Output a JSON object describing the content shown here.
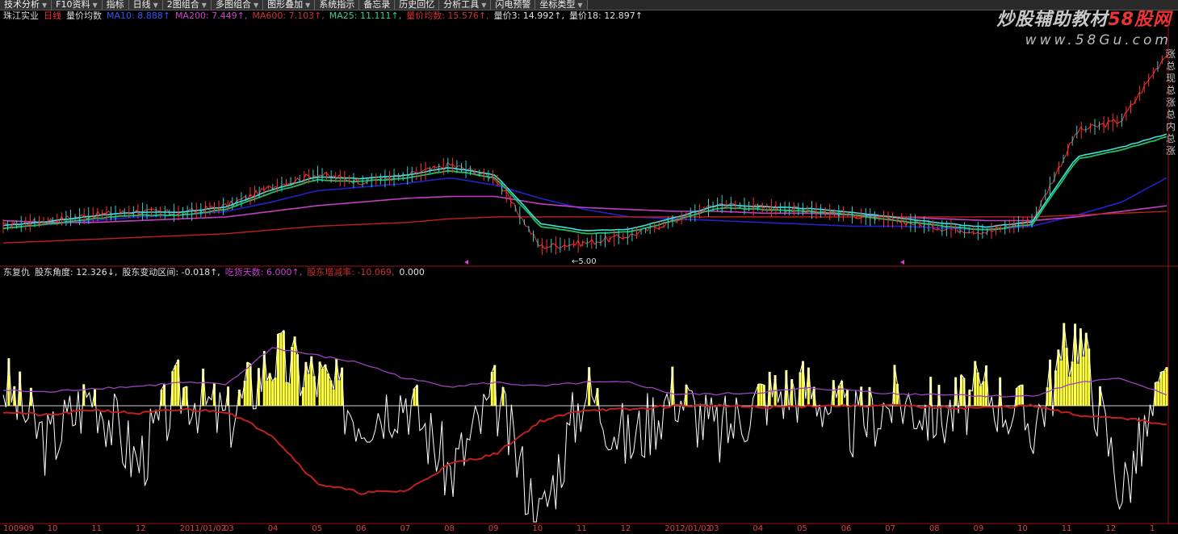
{
  "toolbar": {
    "buttons": [
      {
        "label": "技术分析",
        "dropdown": true
      },
      {
        "label": "F10资料",
        "dropdown": true
      },
      {
        "label": "指标",
        "dropdown": false
      },
      {
        "label": "日线",
        "dropdown": true
      },
      {
        "label": "2图组合",
        "dropdown": true
      },
      {
        "label": "多图组合",
        "dropdown": true
      },
      {
        "label": "图形叠加",
        "dropdown": true
      },
      {
        "label": "系统指示",
        "dropdown": false
      },
      {
        "label": "备忘录",
        "dropdown": false
      },
      {
        "label": "历史回忆",
        "dropdown": false
      },
      {
        "label": "分析工具",
        "dropdown": true
      },
      {
        "label": "闪电预警",
        "dropdown": false
      },
      {
        "label": "坐标类型",
        "dropdown": true
      }
    ],
    "dropdown_glyph": "▼"
  },
  "watermark": {
    "line1_a": "炒股辅助教材",
    "line1_b": "58股网",
    "line2": "www.58Gu.com"
  },
  "main_panel": {
    "stock": "珠江实业",
    "period": "日线",
    "indicator": "量价均数",
    "readouts": [
      {
        "text": "MA10: 8.888↑",
        "color": "#3355ff"
      },
      {
        "text": "MA200: 7.449↑,",
        "color": "#d040d0"
      },
      {
        "text": "MA600: 7.103↑,",
        "color": "#d03030"
      },
      {
        "text": "MA25: 11.111↑,",
        "color": "#30d0a0"
      },
      {
        "text": "量价均数: 15.576↑,",
        "color": "#d03030"
      },
      {
        "text": "量价3: 14.992↑,",
        "color": "#e0e0e0"
      },
      {
        "text": "量价18: 12.897↑",
        "color": "#e0e0e0"
      }
    ],
    "low_marker": "←5.00",
    "side_labels": [
      "涨",
      "总",
      "现",
      "总",
      "涨",
      "总",
      "内",
      "总",
      "涨"
    ]
  },
  "sub_panel": {
    "indicator": "东复仇",
    "readouts": [
      {
        "text": "股东角度: 12.326↓,",
        "color": "#e0e0e0"
      },
      {
        "text": "股东变动区间: -0.018↑,",
        "color": "#e0e0e0"
      },
      {
        "text": "吃货天数: 6.000↑,",
        "color": "#d040d0"
      },
      {
        "text": "股东增减率: -10.069,",
        "color": "#d03030"
      },
      {
        "text": "0.000",
        "color": "#e0e0e0"
      }
    ]
  },
  "date_axis": [
    "100909",
    "10",
    "11",
    "12",
    "2011/01/02",
    "03",
    "04",
    "05",
    "06",
    "07",
    "08",
    "09",
    "10",
    "11",
    "12",
    "2012/01/02",
    "03",
    "04",
    "05",
    "06",
    "07",
    "08",
    "09",
    "10",
    "11",
    "12",
    "1"
  ],
  "colors": {
    "ma_blue": "#2222cc",
    "ma_purple": "#c040c0",
    "ma_red": "#c02020",
    "ma_green": "#20c060",
    "ma_cyan": "#40e0e0",
    "candle_up": "#ff3030",
    "candle_down": "#30d0d0",
    "osc_white": "#ffffff",
    "osc_yellow": "#ffff40",
    "osc_red": "#c02020",
    "osc_purple": "#a040c0",
    "panel_border": "#a01010"
  },
  "chart_data": [
    {
      "type": "line",
      "title": "珠江实业 日线 量价均数",
      "x": [
        "100909",
        "10",
        "11",
        "12",
        "2011/01/02",
        "03",
        "04",
        "05",
        "06",
        "07",
        "08",
        "09",
        "10",
        "11",
        "12",
        "2012/01/02",
        "03",
        "04",
        "05",
        "06",
        "07",
        "08",
        "09",
        "10",
        "11",
        "12",
        "1"
      ],
      "series": [
        {
          "name": "量价均数",
          "values": [
            6.3,
            6.6,
            6.9,
            7.1,
            7.0,
            7.4,
            8.4,
            9.1,
            8.7,
            9.0,
            9.6,
            8.9,
            5.2,
            5.4,
            5.8,
            6.6,
            7.5,
            7.3,
            7.2,
            6.9,
            6.6,
            6.2,
            6.0,
            6.6,
            11.4,
            12.0,
            15.6
          ]
        },
        {
          "name": "MA10",
          "values": [
            6.2,
            6.4,
            6.6,
            6.8,
            6.9,
            7.1,
            7.6,
            8.2,
            8.4,
            8.6,
            8.9,
            8.5,
            7.8,
            7.2,
            6.8,
            6.7,
            6.6,
            6.5,
            6.4,
            6.3,
            6.3,
            6.2,
            6.1,
            6.3,
            6.9,
            7.6,
            8.9
          ]
        },
        {
          "name": "MA200",
          "values": [
            6.6,
            6.5,
            6.5,
            6.6,
            6.7,
            6.8,
            7.1,
            7.4,
            7.6,
            7.8,
            7.9,
            7.9,
            7.5,
            7.3,
            7.2,
            7.1,
            7.1,
            7.0,
            7.0,
            6.9,
            6.8,
            6.7,
            6.6,
            6.6,
            6.8,
            7.1,
            7.4
          ]
        },
        {
          "name": "MA600",
          "values": [
            5.4,
            5.5,
            5.6,
            5.7,
            5.8,
            5.9,
            6.1,
            6.3,
            6.4,
            6.5,
            6.7,
            6.8,
            6.8,
            6.8,
            6.8,
            6.8,
            6.8,
            6.8,
            6.8,
            6.8,
            6.8,
            6.8,
            6.8,
            6.8,
            6.9,
            7.0,
            7.1
          ]
        },
        {
          "name": "MA25",
          "values": [
            6.2,
            6.4,
            6.7,
            6.9,
            6.9,
            7.2,
            8.1,
            8.8,
            8.7,
            8.9,
            9.3,
            8.9,
            6.3,
            5.9,
            6.0,
            6.6,
            7.3,
            7.2,
            7.1,
            6.9,
            6.6,
            6.3,
            6.1,
            6.4,
            9.9,
            10.4,
            11.1
          ]
        }
      ]
    },
    {
      "type": "line",
      "title": "东复仇",
      "x": [
        "100909",
        "10",
        "11",
        "12",
        "2011/01/02",
        "03",
        "04",
        "05",
        "06",
        "07",
        "08",
        "09",
        "10",
        "11",
        "12",
        "2012/01/02",
        "03",
        "04",
        "05",
        "06",
        "07",
        "08",
        "09",
        "10",
        "11",
        "12",
        "1"
      ],
      "series": [
        {
          "name": "股东角度",
          "values": [
            12,
            -20,
            8,
            -30,
            10,
            -8,
            25,
            15,
            -5,
            6,
            -35,
            5,
            -60,
            10,
            -20,
            8,
            -15,
            6,
            10,
            -10,
            4,
            -5,
            8,
            -10,
            40,
            -45,
            12.3
          ]
        },
        {
          "name": "股东变动区间",
          "values": [
            -2,
            -6,
            -4,
            -3,
            -3,
            -2,
            -14,
            -40,
            -48,
            -48,
            -30,
            -26,
            -8,
            -2,
            -1,
            0,
            0,
            -1,
            0,
            0,
            0,
            -1,
            0,
            0,
            -4,
            -4,
            -0.02
          ]
        },
        {
          "name": "吃货天数",
          "values": [
            8,
            7,
            9,
            10,
            12,
            11,
            30,
            26,
            22,
            14,
            10,
            12,
            10,
            12,
            12,
            6,
            6,
            7,
            9,
            8,
            6,
            6,
            5,
            5,
            12,
            14,
            6
          ]
        },
        {
          "name": "股东增减率",
          "values": [
            -3,
            -5,
            -2,
            -4,
            -2,
            -3,
            -15,
            -40,
            -45,
            -44,
            -30,
            -25,
            -8,
            -2,
            -2,
            0,
            0,
            -1,
            0,
            0,
            0,
            -1,
            -1,
            0,
            -5,
            -6,
            -10.1
          ]
        }
      ]
    }
  ]
}
